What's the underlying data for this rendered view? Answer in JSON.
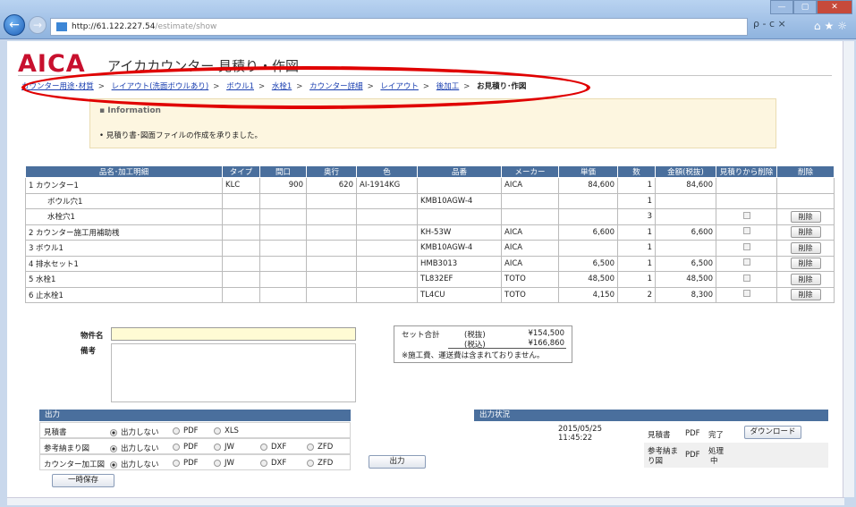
{
  "browser": {
    "url_host": "http://61.122.227.54",
    "url_path": "/estimate/show",
    "search_glyph": "ρ - c ×"
  },
  "header": {
    "logo": "AICA",
    "title": "アイカカウンター 見積り・作図"
  },
  "breadcrumb": {
    "items": [
      "カウンター用途･材質",
      "レイアウト(洗面ボウルあり)",
      "ボウル1",
      "水栓1",
      "カウンター詳細",
      "レイアウト",
      "後加工"
    ],
    "current": "お見積り･作図",
    "separator": ">"
  },
  "info": {
    "heading": "▪ Information",
    "message": "• 見積り書･図面ファイルの作成を承りました。"
  },
  "table": {
    "headers": [
      "品名･加工明細",
      "タイプ",
      "間口",
      "奥行",
      "色",
      "品番",
      "メーカー",
      "単価",
      "数",
      "金額(税抜)",
      "見積りから削除",
      "削除"
    ],
    "rows": [
      {
        "no": "1",
        "name": "カウンター1",
        "type": "KLC",
        "width": "900",
        "depth": "620",
        "color": "AI-1914KG",
        "part": "",
        "maker": "AICA",
        "price": "84,600",
        "qty": "1",
        "amount": "84,600",
        "check": false,
        "del": false
      },
      {
        "no": "",
        "name": "ボウル穴1",
        "type": "",
        "width": "",
        "depth": "",
        "color": "",
        "part": "KMB10AGW-4",
        "maker": "",
        "price": "",
        "qty": "1",
        "amount": "",
        "check": false,
        "del": false
      },
      {
        "no": "",
        "name": "水栓穴1",
        "type": "",
        "width": "",
        "depth": "",
        "color": "",
        "part": "",
        "maker": "",
        "price": "",
        "qty": "3",
        "amount": "",
        "check": true,
        "del": true
      },
      {
        "no": "2",
        "name": "カウンター施工用補助桟",
        "type": "",
        "width": "",
        "depth": "",
        "color": "",
        "part": "KH-53W",
        "maker": "AICA",
        "price": "6,600",
        "qty": "1",
        "amount": "6,600",
        "check": true,
        "del": true
      },
      {
        "no": "3",
        "name": "ボウル1",
        "type": "",
        "width": "",
        "depth": "",
        "color": "",
        "part": "KMB10AGW-4",
        "maker": "AICA",
        "price": "",
        "qty": "1",
        "amount": "",
        "check": true,
        "del": true
      },
      {
        "no": "4",
        "name": "排水セット1",
        "type": "",
        "width": "",
        "depth": "",
        "color": "",
        "part": "HMB3013",
        "maker": "AICA",
        "price": "6,500",
        "qty": "1",
        "amount": "6,500",
        "check": true,
        "del": true
      },
      {
        "no": "5",
        "name": "水栓1",
        "type": "",
        "width": "",
        "depth": "",
        "color": "",
        "part": "TL832EF",
        "maker": "TOTO",
        "price": "48,500",
        "qty": "1",
        "amount": "48,500",
        "check": true,
        "del": true
      },
      {
        "no": "6",
        "name": "止水栓1",
        "type": "",
        "width": "",
        "depth": "",
        "color": "",
        "part": "TL4CU",
        "maker": "TOTO",
        "price": "4,150",
        "qty": "2",
        "amount": "8,300",
        "check": true,
        "del": true
      }
    ],
    "delete_label": "削除"
  },
  "form": {
    "property_label": "物件名",
    "memo_label": "備考",
    "property_value": "",
    "memo_value": ""
  },
  "totals": {
    "label": "セット合計",
    "excl_label": "(税抜)",
    "excl_value": "¥154,500",
    "incl_label": "(税込)",
    "incl_value": "¥166,860",
    "note": "※施工費、運送費は含まれておりません。"
  },
  "output": {
    "heading": "出力",
    "rows": [
      {
        "label": "見積書",
        "options": [
          "出力しない",
          "PDF",
          "XLS"
        ]
      },
      {
        "label": "参考納まり図",
        "options": [
          "出力しない",
          "PDF",
          "JW",
          "DXF",
          "ZFD"
        ]
      },
      {
        "label": "カウンター加工図",
        "options": [
          "出力しない",
          "PDF",
          "JW",
          "DXF",
          "ZFD"
        ]
      }
    ],
    "button": "出力",
    "save_button": "一時保存"
  },
  "status": {
    "heading": "出力状況",
    "date": "2015/05/25",
    "time": "11:45:22",
    "estimate_label": "見積書",
    "estimate_type": "PDF",
    "estimate_state": "完了",
    "download": "ダウンロード",
    "ref_label_1": "参考納ま",
    "ref_label_2": "り図",
    "ref_type": "PDF",
    "ref_state_1": "処理",
    "ref_state_2": "中"
  },
  "colors": {
    "brand": "#c8102e",
    "table_header": "#4a6f9d",
    "highlight_oval": "#e00000",
    "info_bg": "#fdf6e0"
  }
}
